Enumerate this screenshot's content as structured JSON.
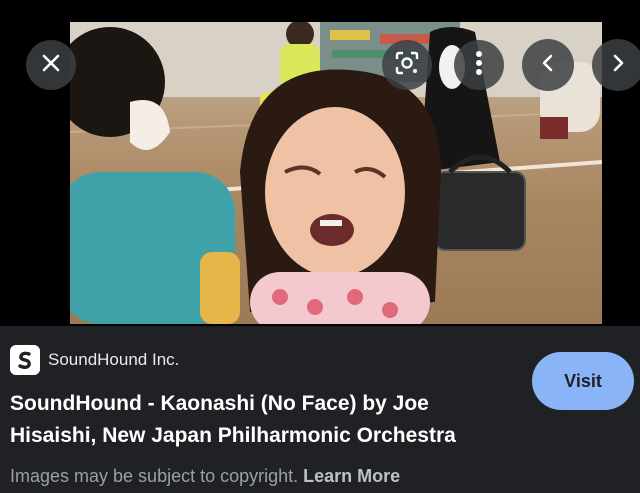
{
  "viewer": {
    "close_icon": "close-icon",
    "lens_icon": "lens-icon",
    "more_icon": "more-vert-icon",
    "prev_icon": "chevron-left-icon",
    "next_icon": "chevron-right-icon"
  },
  "source": {
    "name": "SoundHound Inc.",
    "logo_icon": "soundhound-logo"
  },
  "result": {
    "title": "SoundHound - Kaonashi (No Face) by Joe Hisaishi, New Japan Philharmonic Orchestra",
    "visit_label": "Visit"
  },
  "footer": {
    "notice": "Images may be subject to copyright.",
    "learn_more": "Learn More"
  },
  "colors": {
    "background": "#202124",
    "visit_button": "#8ab4f8",
    "text_primary": "#ffffff",
    "text_muted": "#9aa0a6"
  }
}
